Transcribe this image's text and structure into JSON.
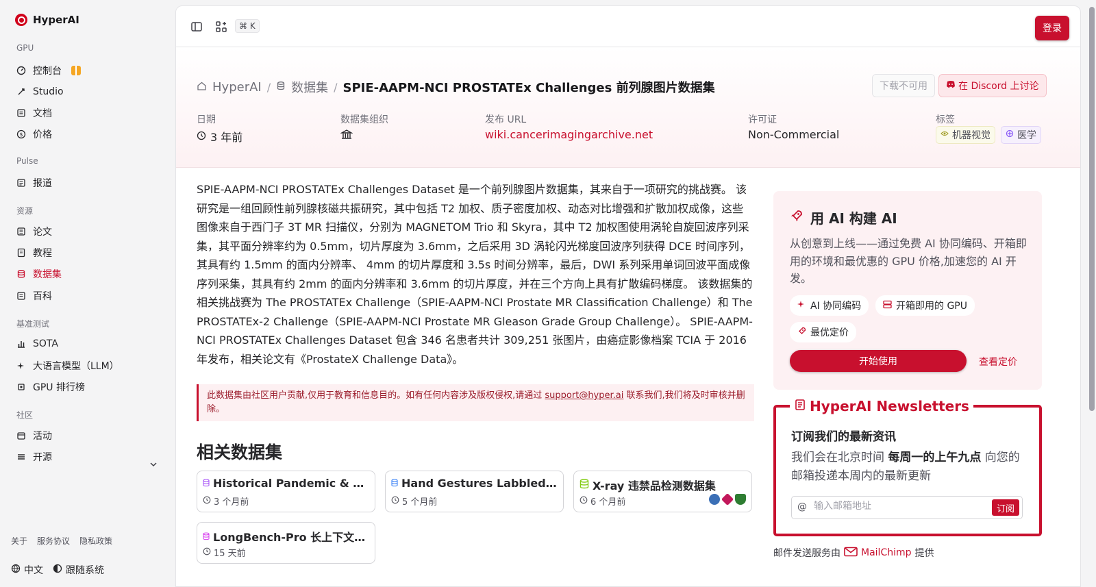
{
  "app": {
    "name": "HyperAI"
  },
  "sidebar": {
    "sections": [
      {
        "label": "GPU",
        "items": [
          {
            "label": "控制台",
            "icon": "dashboard-icon"
          },
          {
            "label": "Studio",
            "icon": "link-icon"
          },
          {
            "label": "文档",
            "icon": "doc-icon"
          },
          {
            "label": "价格",
            "icon": "price-icon"
          }
        ]
      },
      {
        "label": "Pulse",
        "items": [
          {
            "label": "报道",
            "icon": "news-icon"
          }
        ]
      },
      {
        "label": "资源",
        "items": [
          {
            "label": "论文",
            "icon": "paper-icon"
          },
          {
            "label": "教程",
            "icon": "tutorial-icon"
          },
          {
            "label": "数据集",
            "icon": "database-icon",
            "active": true
          },
          {
            "label": "百科",
            "icon": "wiki-icon"
          }
        ]
      },
      {
        "label": "基准测试",
        "items": [
          {
            "label": "SOTA",
            "icon": "bar-chart-icon"
          },
          {
            "label": "大语言模型（LLM）",
            "icon": "sparkle-icon"
          },
          {
            "label": "GPU 排行榜",
            "icon": "chip-icon"
          }
        ]
      },
      {
        "label": "社区",
        "items": [
          {
            "label": "活动",
            "icon": "calendar-icon"
          },
          {
            "label": "开源",
            "icon": "list-icon"
          }
        ]
      }
    ],
    "footer_links": [
      "关于",
      "服务协议",
      "隐私政策"
    ],
    "language": "中文",
    "theme": "跟随系统"
  },
  "topbar": {
    "shortcut": "⌘ K",
    "login_label": "登录"
  },
  "breadcrumb": {
    "home": "HyperAI",
    "section": "数据集",
    "current": "SPIE-AAPM-NCI PROSTATEx Challenges 前列腺图片数据集"
  },
  "actions": {
    "download_label": "下载不可用",
    "discord_label": "在 Discord 上讨论"
  },
  "meta": {
    "date_label": "日期",
    "date_value": "3 年前",
    "org_label": "数据集组织",
    "url_label": "发布 URL",
    "url_value": "wiki.cancerimagingarchive.net",
    "license_label": "许可证",
    "license_value": "Non-Commercial",
    "tags_label": "标签",
    "tags": [
      "机器视觉",
      "医学"
    ]
  },
  "description": "SPIE-AAPM-NCI PROSTATEx Challenges Dataset 是一个前列腺图片数据集，其来自于一项研究的挑战赛。 该研究是一组回顾性前列腺核磁共振研究，其中包括 T2 加权、质子密度加权、动态对比增强和扩散加权成像，这些图像来自于西门子 3T MR 扫描仪，分别为 MAGNETOM Trio 和 Skyra，其中 T2 加权图使用涡轮自旋回波序列采集，其平面分辨率约为 0.5mm，切片厚度为 3.6mm，之后采用 3D 涡轮闪光梯度回波序列获得 DCE 时间序列，其具有约 1.5mm 的面内分辨率、 4mm 的切片厚度和 3.5s 时间分辨率，最后，DWI 系列采用单词回波平面成像序列采集，其具有约 2mm 的面内分辨率和 3.6mm 的切片厚度，并在三个方向上具有扩散编码梯度。 该数据集的相关挑战赛为 The PROSTATEx Challenge（SPIE-AAPM-NCI Prostate MR Classification Challenge）和 The PROSTATEx-2 Challenge（SPIE-AAPM-NCI Prostate MR Gleason Grade Group Challenge）。 SPIE-AAPM-NCI PROSTATEx Challenges Dataset 包含 346 名患者共计 309,251 张图片，由癌症影像档案 TCIA 于 2016 年发布，相关论文有《ProstateX Challenge Data》。",
  "notice": {
    "before": "此数据集由社区用户贡献,仅用于教育和信息目的。如有任何内容涉及版权侵权,请通过 ",
    "email": "support@hyper.ai",
    "after": " 联系我们,我们将及时审核并删除。"
  },
  "related": {
    "title": "相关数据集",
    "items": [
      {
        "title": "Historical Pandemic & Epidemic",
        "time": "3 个月前"
      },
      {
        "title": "Hand Gestures Labbled Dataset",
        "time": "5 个月前"
      },
      {
        "title": "X-ray 违禁品检测数据集",
        "time": "6 个月前"
      },
      {
        "title": "LongBench-Pro 长上下文评测",
        "time": "15 天前"
      }
    ]
  },
  "promo": {
    "title": "用 AI 构建 AI",
    "text": "从创意到上线——通过免费 AI 协同编码、开箱即用的环境和最优惠的 GPU 价格,加速您的 AI 开发。",
    "chips": [
      "AI 协同编码",
      "开箱即用的 GPU",
      "最优定价"
    ],
    "start_label": "开始使用",
    "pricing_label": "查看定价"
  },
  "newsletter": {
    "title": "HyperAI Newsletters",
    "subtitle": "订阅我们的最新资讯",
    "text_before": "我们会在北京时间 ",
    "text_bold": "每周一的上午九点",
    "text_after": " 向您的邮箱投递本周内的最新更新",
    "placeholder": "输入邮箱地址",
    "subscribe_label": "订阅",
    "service_before": "邮件发送服务由",
    "service_name": "MailChimp",
    "service_after": "提供"
  },
  "colors": {
    "brand": "#c8102e",
    "promo_bg": "#fdf1f3"
  }
}
